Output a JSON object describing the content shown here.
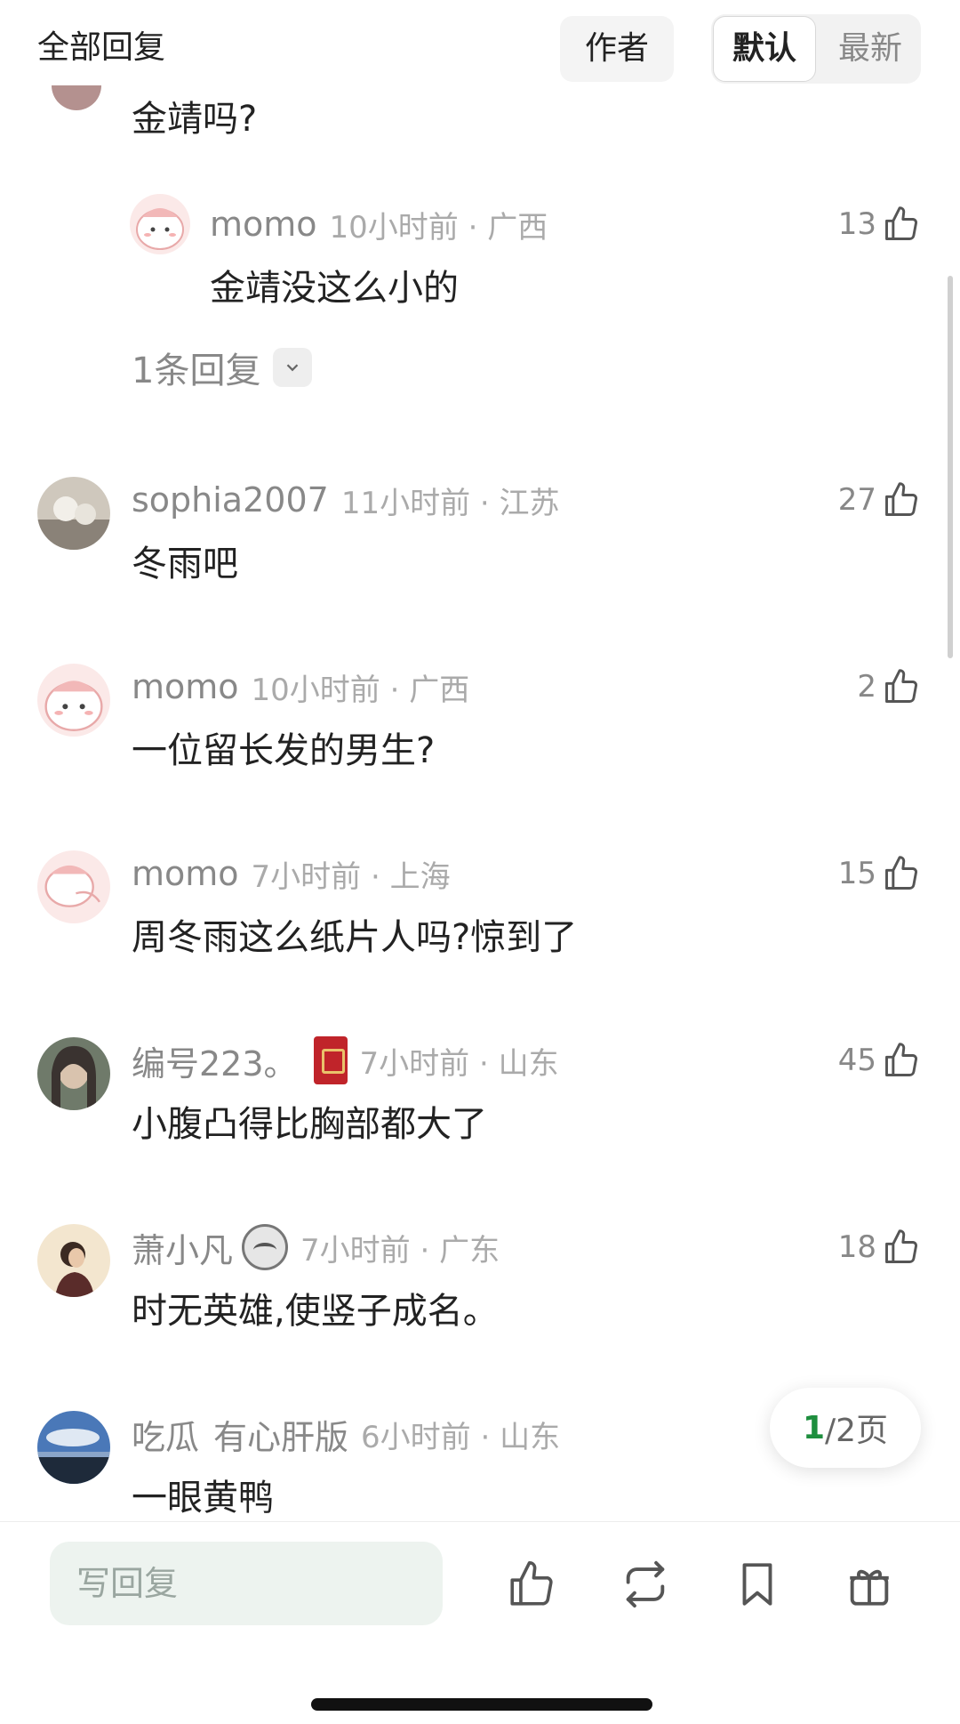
{
  "header": {
    "title": "全部回复",
    "author_label": "作者",
    "sort": {
      "default_label": "默认",
      "latest_label": "最新",
      "active": "默认"
    }
  },
  "partial_comment": {
    "text": "金靖吗?"
  },
  "sub_reply": {
    "user": "momo",
    "time_location": "10小时前 · 广西",
    "text": "金靖没这么小的",
    "likes": "13",
    "replies_label": "1条回复"
  },
  "comments": [
    {
      "user": "sophia2007",
      "time_location": "11小时前 · 江苏",
      "text": "冬雨吧",
      "likes": "27"
    },
    {
      "user": "momo",
      "time_location": "10小时前 · 广西",
      "text": "一位留长发的男生?",
      "likes": "2"
    },
    {
      "user": "momo",
      "time_location": "7小时前 · 上海",
      "text": "周冬雨这么纸片人吗?惊到了",
      "likes": "15"
    },
    {
      "user": "编号223。",
      "time_location": "7小时前 · 山东",
      "text": "小腹凸得比胸部都大了",
      "likes": "45"
    },
    {
      "user": "萧小凡",
      "time_location": "7小时前 · 广东",
      "text": "时无英雄,使竖子成名。",
      "likes": "18"
    },
    {
      "user": "吃瓜",
      "extra": "有心肝版",
      "time_location": "6小时前 · 山东",
      "text": "一眼黄鸭"
    }
  ],
  "pager": {
    "current": "1",
    "total_suffix": "/2页"
  },
  "bottom_bar": {
    "placeholder": "写回复"
  },
  "icons": {
    "like": "thumbs-up-icon",
    "repost": "repost-icon",
    "bookmark": "bookmark-icon",
    "gift": "gift-icon"
  },
  "colors": {
    "accent_green": "#1e8e3e",
    "input_bg": "#edf3ef",
    "meta_gray": "#888888"
  }
}
